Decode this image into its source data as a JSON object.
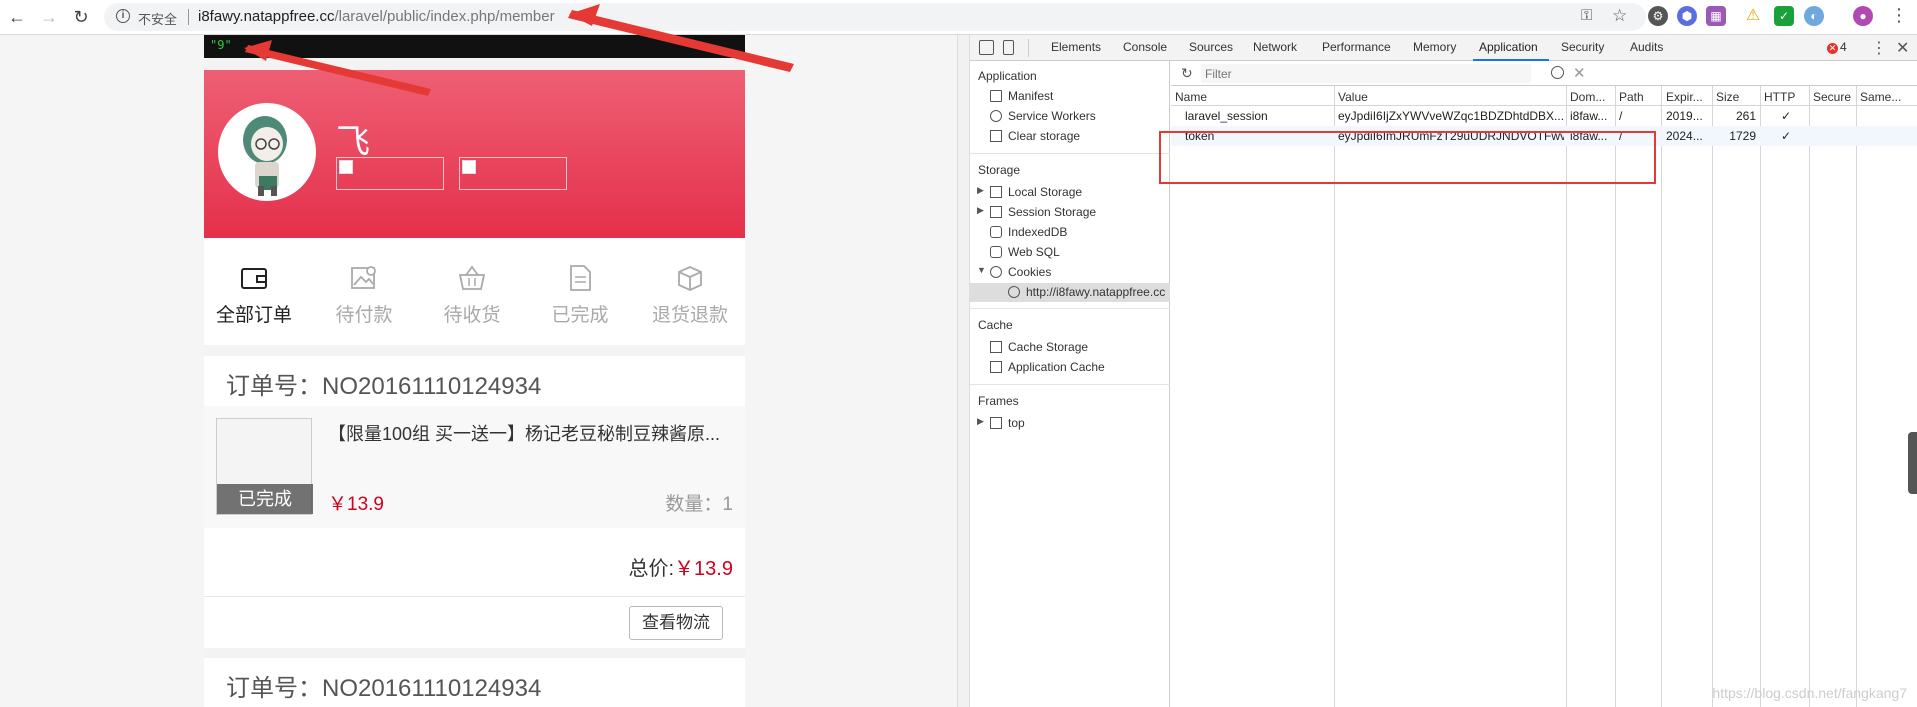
{
  "browser": {
    "insecure_label": "不安全",
    "url_host": "i8fawy.natappfree.cc",
    "url_path": "/laravel/public/index.php/member"
  },
  "mobile": {
    "debug_output": "\"9\"",
    "profile_name": "飞",
    "order_tabs": [
      {
        "label": "全部订单",
        "icon": "wallet-icon"
      },
      {
        "label": "待付款",
        "icon": "image-card-icon"
      },
      {
        "label": "待收货",
        "icon": "basket-icon"
      },
      {
        "label": "已完成",
        "icon": "document-icon"
      },
      {
        "label": "退货退款",
        "icon": "box-icon"
      }
    ],
    "orders": [
      {
        "order_no": "订单号：NO20161110124934",
        "item_title": "【限量100组 买一送一】杨记老豆秘制豆辣酱原...",
        "status": "已完成",
        "price": "￥13.9",
        "quantity": "数量：1",
        "total_label": "总价:",
        "total_value": "￥13.9",
        "logistics_button": "查看物流"
      },
      {
        "order_no": "订单号：NO20161110124934"
      }
    ]
  },
  "devtools": {
    "tabs": [
      "Elements",
      "Console",
      "Sources",
      "Network",
      "Performance",
      "Memory",
      "Application",
      "Security",
      "Audits"
    ],
    "active_tab": "Application",
    "error_count": "4",
    "sidebar": {
      "application_title": "Application",
      "application_items": [
        "Manifest",
        "Service Workers",
        "Clear storage"
      ],
      "storage_title": "Storage",
      "storage_items": [
        "Local Storage",
        "Session Storage",
        "IndexedDB",
        "Web SQL",
        "Cookies"
      ],
      "cookie_origin": "http://i8fawy.natappfree.cc",
      "cache_title": "Cache",
      "cache_items": [
        "Cache Storage",
        "Application Cache"
      ],
      "frames_title": "Frames",
      "frames_items": [
        "top"
      ]
    },
    "filter_placeholder": "Filter",
    "columns": [
      "Name",
      "Value",
      "Dom...",
      "Path",
      "Expir...",
      "Size",
      "HTTP",
      "Secure",
      "Same..."
    ],
    "cookies": [
      {
        "name": "laravel_session",
        "value": "eyJpdiI6IjZxYWVveWZqc1BDZDhtdDBX...",
        "domain": "i8faw...",
        "path": "/",
        "expires": "2019...",
        "size": "261",
        "http": "✓",
        "secure": "",
        "same": ""
      },
      {
        "name": "token",
        "value": "eyJpdiI6ImJRUmFzT29uUDRJNDVOTFwv...",
        "domain": "i8faw...",
        "path": "/",
        "expires": "2024...",
        "size": "1729",
        "http": "✓",
        "secure": "",
        "same": ""
      }
    ]
  },
  "watermark": "https://blog.csdn.net/fangkang7"
}
